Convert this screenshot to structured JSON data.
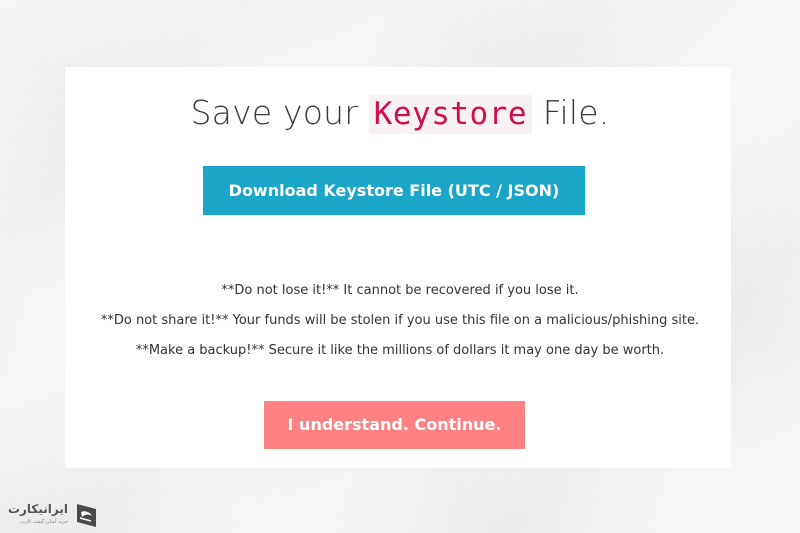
{
  "title": {
    "prefix": "Save your",
    "code": "Keystore",
    "suffix": "File."
  },
  "download_button": {
    "label": "Download Keystore File (UTC / JSON)"
  },
  "warnings": [
    "**Do not lose it!** It cannot be recovered if you lose it.",
    "**Do not share it!** Your funds will be stolen if you use this file on a malicious/phishing site.",
    "**Make a backup!** Secure it like the millions of dollars it may one day be worth."
  ],
  "continue_button": {
    "label": "I understand. Continue."
  },
  "watermark": {
    "text": "ایرانیکارت",
    "subtext": "خرید آسان گیفت کارت"
  },
  "colors": {
    "download_button": "#1ba5c8",
    "continue_button": "#ff8282",
    "code_text": "#d0104c",
    "code_background": "#f9f2f4"
  }
}
